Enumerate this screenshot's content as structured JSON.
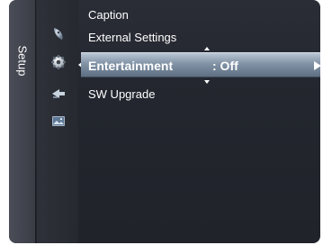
{
  "sidebar": {
    "label": "Setup"
  },
  "menu": {
    "items": [
      {
        "label": "Caption"
      },
      {
        "label": "External Settings"
      },
      {
        "label": "Entertainment",
        "value": ": Off",
        "selected": true
      },
      {
        "label": "SW Upgrade"
      }
    ]
  },
  "icons": {
    "side": [
      "satellite-dish-icon",
      "settings-gear-icon",
      "input-arrow-icon",
      "picture-icon"
    ],
    "selected_indicator": "triangle-left-icon",
    "submenu_indicator": "triangle-right-icon",
    "scroll_up": "scroll-up-icon",
    "scroll_down": "scroll-down-icon"
  },
  "colors": {
    "background": "#23262e",
    "highlight": "#8293a6",
    "text": "#ffffff"
  }
}
